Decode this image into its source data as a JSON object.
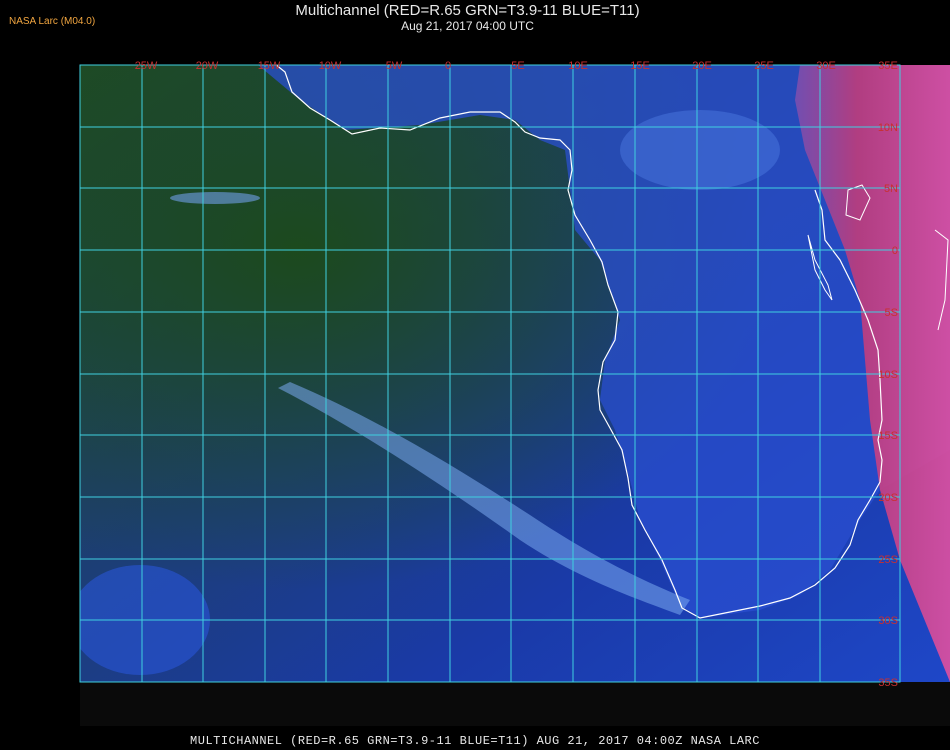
{
  "header": {
    "logo": "NASA Larc (M04.0)",
    "title": "Multichannel (RED=R.65 GRN=T3.9-11 BLUE=T11)",
    "subtitle": "Aug 21, 2017 04:00 UTC"
  },
  "footer": {
    "caption": "MULTICHANNEL (RED=R.65 GRN=T3.9-11 BLUE=T11) AUG 21, 2017 04:00Z NASA LARC"
  },
  "map": {
    "longitude_labels": [
      "25W",
      "20W",
      "15W",
      "10W",
      "5W",
      "0",
      "5E",
      "10E",
      "15E",
      "20E",
      "25E",
      "30E",
      "35E"
    ],
    "latitude_labels": [
      "10N",
      "5N",
      "0",
      "5S",
      "10S",
      "15S",
      "20S",
      "25S",
      "30S",
      "35S",
      "40S"
    ],
    "colors": {
      "grid": "#3fd0e0",
      "label": "#c83030",
      "coast": "#ffffff",
      "ocean_deep": "#1a3fb0",
      "ocean_green": "#1c4a1e",
      "land": "#d04080"
    }
  }
}
